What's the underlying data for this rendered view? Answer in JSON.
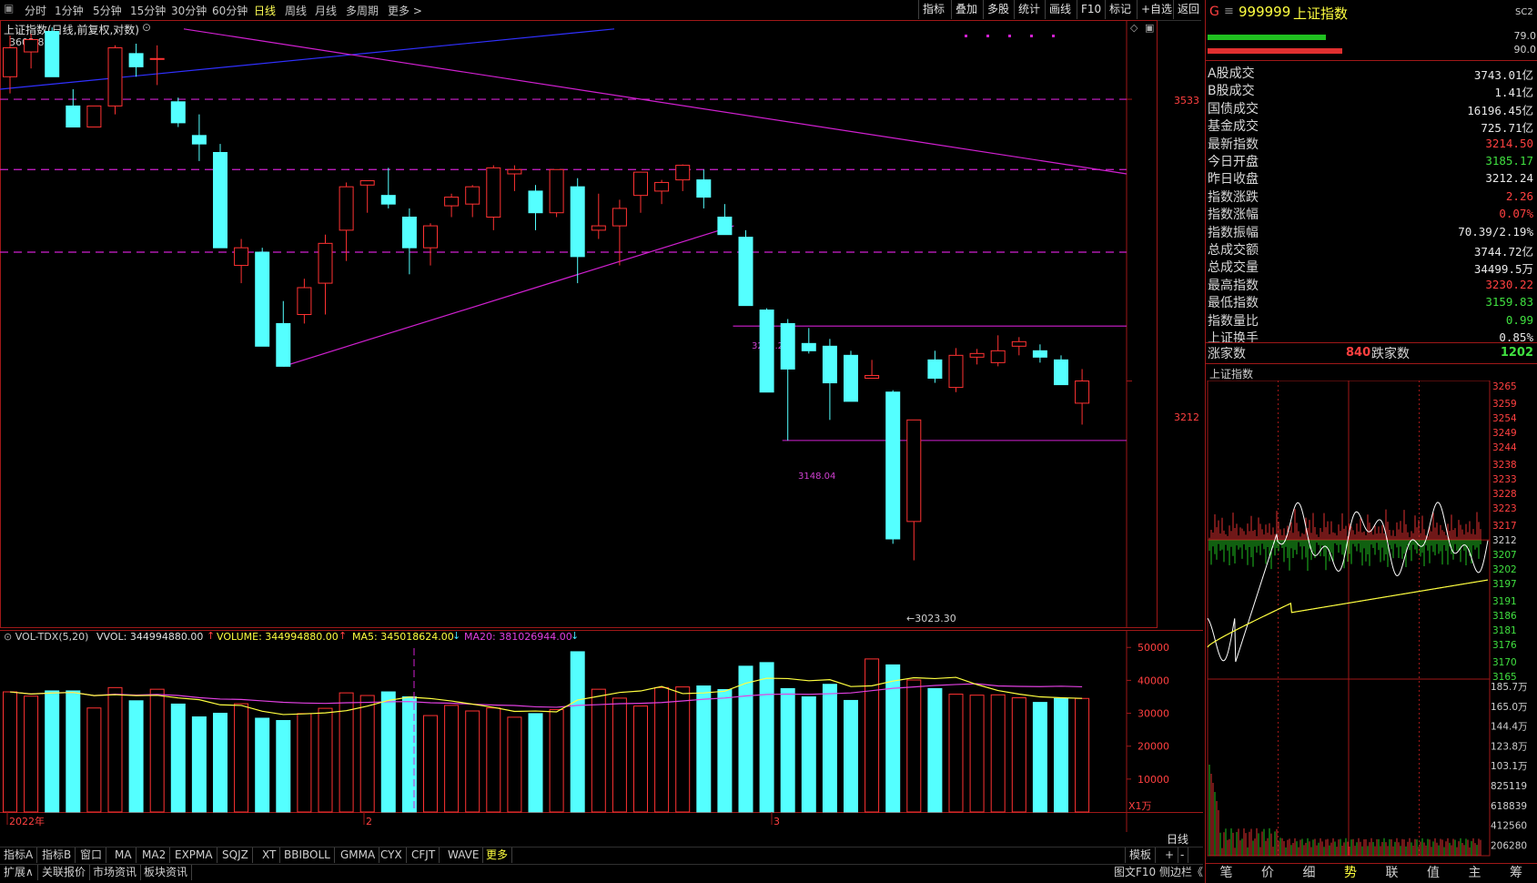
{
  "toolbar": {
    "periods": [
      "分时",
      "1分钟",
      "5分钟",
      "15分钟",
      "30分钟",
      "60分钟",
      "日线",
      "周线",
      "月线",
      "多周期",
      "更多 >"
    ],
    "active_period": "日线",
    "tools": [
      "指标",
      "叠加",
      "多股",
      "统计",
      "画线",
      "F10",
      "标记",
      "+自选",
      "返回"
    ]
  },
  "chart_header": {
    "title": "上证指数(日线,前复权,对数)",
    "first_value": "3602.8"
  },
  "price_axis": {
    "upper_label": "3533",
    "lower_label": "3212"
  },
  "annotations": {
    "high_label": "3272.20",
    "low_label": "3148.04",
    "min_label": "3023.30"
  },
  "chart_data": {
    "type": "candlestick",
    "series_name": "上证指数",
    "ylog": true,
    "ylim": [
      2960,
      3620
    ],
    "candles": [
      {
        "o": 3560,
        "h": 3610,
        "l": 3540,
        "c": 3595
      },
      {
        "o": 3590,
        "h": 3612,
        "l": 3570,
        "c": 3605
      },
      {
        "o": 3615,
        "h": 3620,
        "l": 3560,
        "c": 3560
      },
      {
        "o": 3525,
        "h": 3545,
        "l": 3500,
        "c": 3500
      },
      {
        "o": 3500,
        "h": 3525,
        "l": 3500,
        "c": 3525
      },
      {
        "o": 3525,
        "h": 3598,
        "l": 3515,
        "c": 3595
      },
      {
        "o": 3588,
        "h": 3600,
        "l": 3560,
        "c": 3572
      },
      {
        "o": 3582,
        "h": 3598,
        "l": 3550,
        "c": 3582
      },
      {
        "o": 3530,
        "h": 3535,
        "l": 3500,
        "c": 3505
      },
      {
        "o": 3490,
        "h": 3515,
        "l": 3460,
        "c": 3480
      },
      {
        "o": 3470,
        "h": 3480,
        "l": 3360,
        "c": 3360
      },
      {
        "o": 3340,
        "h": 3370,
        "l": 3320,
        "c": 3360
      },
      {
        "o": 3355,
        "h": 3360,
        "l": 3250,
        "c": 3250
      },
      {
        "o": 3275,
        "h": 3300,
        "l": 3235,
        "c": 3228
      },
      {
        "o": 3285,
        "h": 3325,
        "l": 3275,
        "c": 3315
      },
      {
        "o": 3320,
        "h": 3375,
        "l": 3285,
        "c": 3365
      },
      {
        "o": 3380,
        "h": 3435,
        "l": 3345,
        "c": 3430
      },
      {
        "o": 3432,
        "h": 3437,
        "l": 3400,
        "c": 3437
      },
      {
        "o": 3420,
        "h": 3452,
        "l": 3405,
        "c": 3410
      },
      {
        "o": 3395,
        "h": 3405,
        "l": 3330,
        "c": 3360
      },
      {
        "o": 3360,
        "h": 3388,
        "l": 3340,
        "c": 3385
      },
      {
        "o": 3408,
        "h": 3422,
        "l": 3395,
        "c": 3418
      },
      {
        "o": 3410,
        "h": 3432,
        "l": 3395,
        "c": 3430
      },
      {
        "o": 3395,
        "h": 3455,
        "l": 3380,
        "c": 3452
      },
      {
        "o": 3445,
        "h": 3455,
        "l": 3425,
        "c": 3450
      },
      {
        "o": 3425,
        "h": 3432,
        "l": 3380,
        "c": 3400
      },
      {
        "o": 3400,
        "h": 3450,
        "l": 3395,
        "c": 3450
      },
      {
        "o": 3430,
        "h": 3440,
        "l": 3320,
        "c": 3350
      },
      {
        "o": 3380,
        "h": 3422,
        "l": 3370,
        "c": 3385
      },
      {
        "o": 3385,
        "h": 3415,
        "l": 3340,
        "c": 3405
      },
      {
        "o": 3420,
        "h": 3447,
        "l": 3400,
        "c": 3447
      },
      {
        "o": 3425,
        "h": 3438,
        "l": 3410,
        "c": 3435
      },
      {
        "o": 3438,
        "h": 3456,
        "l": 3425,
        "c": 3455
      },
      {
        "o": 3438,
        "h": 3450,
        "l": 3405,
        "c": 3418
      },
      {
        "o": 3395,
        "h": 3410,
        "l": 3375,
        "c": 3375
      },
      {
        "o": 3372,
        "h": 3380,
        "l": 3295,
        "c": 3295
      },
      {
        "o": 3290,
        "h": 3292,
        "l": 3200,
        "c": 3200
      },
      {
        "o": 3275,
        "h": 3280,
        "l": 3148,
        "c": 3225
      },
      {
        "o": 3253,
        "h": 3270,
        "l": 3242,
        "c": 3245
      },
      {
        "o": 3250,
        "h": 3258,
        "l": 3170,
        "c": 3210
      },
      {
        "o": 3240,
        "h": 3245,
        "l": 3190,
        "c": 3190
      },
      {
        "o": 3215,
        "h": 3235,
        "l": 3215,
        "c": 3218
      },
      {
        "o": 3200,
        "h": 3202,
        "l": 3040,
        "c": 3045
      },
      {
        "o": 3063,
        "h": 3078,
        "l": 3023,
        "c": 3170
      },
      {
        "o": 3235,
        "h": 3245,
        "l": 3210,
        "c": 3215
      },
      {
        "o": 3205,
        "h": 3248,
        "l": 3200,
        "c": 3240
      },
      {
        "o": 3238,
        "h": 3247,
        "l": 3230,
        "c": 3242
      },
      {
        "o": 3232,
        "h": 3262,
        "l": 3228,
        "c": 3245
      },
      {
        "o": 3250,
        "h": 3260,
        "l": 3240,
        "c": 3255
      },
      {
        "o": 3245,
        "h": 3252,
        "l": 3232,
        "c": 3238
      },
      {
        "o": 3235,
        "h": 3240,
        "l": 3210,
        "c": 3208
      },
      {
        "o": 3188,
        "h": 3225,
        "l": 3165,
        "c": 3212
      }
    ],
    "volume_name": "VOL-TDX(5,20)",
    "volume_unit": "X1万",
    "volume_ticks": [
      "50000",
      "40000",
      "30000",
      "20000",
      "10000"
    ],
    "volumes": [
      36500,
      35200,
      36800,
      36800,
      31600,
      37800,
      33800,
      37300,
      32800,
      28900,
      30000,
      32900,
      28500,
      27800,
      29900,
      31500,
      36200,
      35400,
      36500,
      35000,
      29300,
      32400,
      30700,
      31600,
      28800,
      29900,
      31100,
      48700,
      37300,
      34600,
      32200,
      37800,
      38000,
      38300,
      37200,
      44300,
      45400,
      37500,
      35000,
      38800,
      33900,
      46500,
      44700,
      40100,
      37500,
      35800,
      35500,
      35600,
      34700,
      33300,
      34500,
      34500
    ],
    "volume_labels": {
      "vvol": "VVOL: 344994880.00",
      "volume": "VOLUME: 344994880.00",
      "ma5": "MA5: 345018624.00",
      "ma20": "MA20: 381026944.00"
    },
    "x_labels": [
      "2022年",
      "2",
      "3"
    ],
    "dashed_levels": [
      3533,
      3450,
      3355
    ],
    "h_lines": [
      3272.2,
      3148.04
    ]
  },
  "left_tabs": [
    "指标A",
    "指标B",
    "窗口",
    "MA",
    "MA2",
    "EXPMA",
    "SQJZ",
    "XT",
    "BBIBOLL",
    "GMMA",
    "CYX",
    "CFJT",
    "WAVE",
    "更多"
  ],
  "bottom_tabs": [
    "扩展∧",
    "关联报价",
    "市场资讯",
    "板块资讯"
  ],
  "bottom_right": [
    "模板",
    "+",
    "-",
    "日线"
  ],
  "bottom_status": "图文F10 侧边栏《",
  "right_panel": {
    "header_code": "999999",
    "header_name": "上证指数",
    "header_badge": "SC2",
    "top_bars": {
      "a": "79.0",
      "b": "90.0"
    },
    "rows": [
      {
        "k": "A股成交",
        "v": "3743.01亿",
        "c": "#e8e8e8"
      },
      {
        "k": "B股成交",
        "v": "1.41亿",
        "c": "#e8e8e8"
      },
      {
        "k": "国债成交",
        "v": "16196.45亿",
        "c": "#e8e8e8"
      },
      {
        "k": "基金成交",
        "v": "725.71亿",
        "c": "#e8e8e8"
      },
      {
        "k": "最新指数",
        "v": "3214.50",
        "c": "#ff4040"
      },
      {
        "k": "今日开盘",
        "v": "3185.17",
        "c": "#40e040"
      },
      {
        "k": "昨日收盘",
        "v": "3212.24",
        "c": "#e8e8e8"
      },
      {
        "k": "指数涨跌",
        "v": "2.26",
        "c": "#ff4040"
      },
      {
        "k": "指数涨幅",
        "v": "0.07%",
        "c": "#ff4040"
      },
      {
        "k": "指数振幅",
        "v": "70.39/2.19%",
        "c": "#e8e8e8"
      },
      {
        "k": "总成交额",
        "v": "3744.72亿",
        "c": "#e8e8e8"
      },
      {
        "k": "总成交量",
        "v": "34499.5万",
        "c": "#e8e8e8"
      },
      {
        "k": "最高指数",
        "v": "3230.22",
        "c": "#ff4040"
      },
      {
        "k": "最低指数",
        "v": "3159.83",
        "c": "#40e040"
      },
      {
        "k": "指数量比",
        "v": "0.99",
        "c": "#40e040"
      },
      {
        "k": "上证换手",
        "v": "0.85%",
        "c": "#e8e8e8"
      }
    ],
    "up_label": "涨家数",
    "up_count": "840",
    "down_label": "跌家数",
    "down_count": "1202",
    "mini_title": "上证指数",
    "mini_price_ticks": [
      "3265",
      "3259",
      "3254",
      "3249",
      "3244",
      "3238",
      "3233",
      "3228",
      "3223",
      "3217",
      "3212",
      "3207",
      "3202",
      "3197",
      "3191",
      "3186",
      "3181",
      "3176",
      "3170",
      "3165"
    ],
    "mini_vol_ticks": [
      "185.7万",
      "165.0万",
      "144.4万",
      "123.8万",
      "103.1万",
      "825119",
      "618839",
      "412560",
      "206280"
    ],
    "mini_tabs": [
      "笔",
      "价",
      "细",
      "势",
      "联",
      "值",
      "主",
      "筹"
    ],
    "mini_active_tab": "势"
  }
}
